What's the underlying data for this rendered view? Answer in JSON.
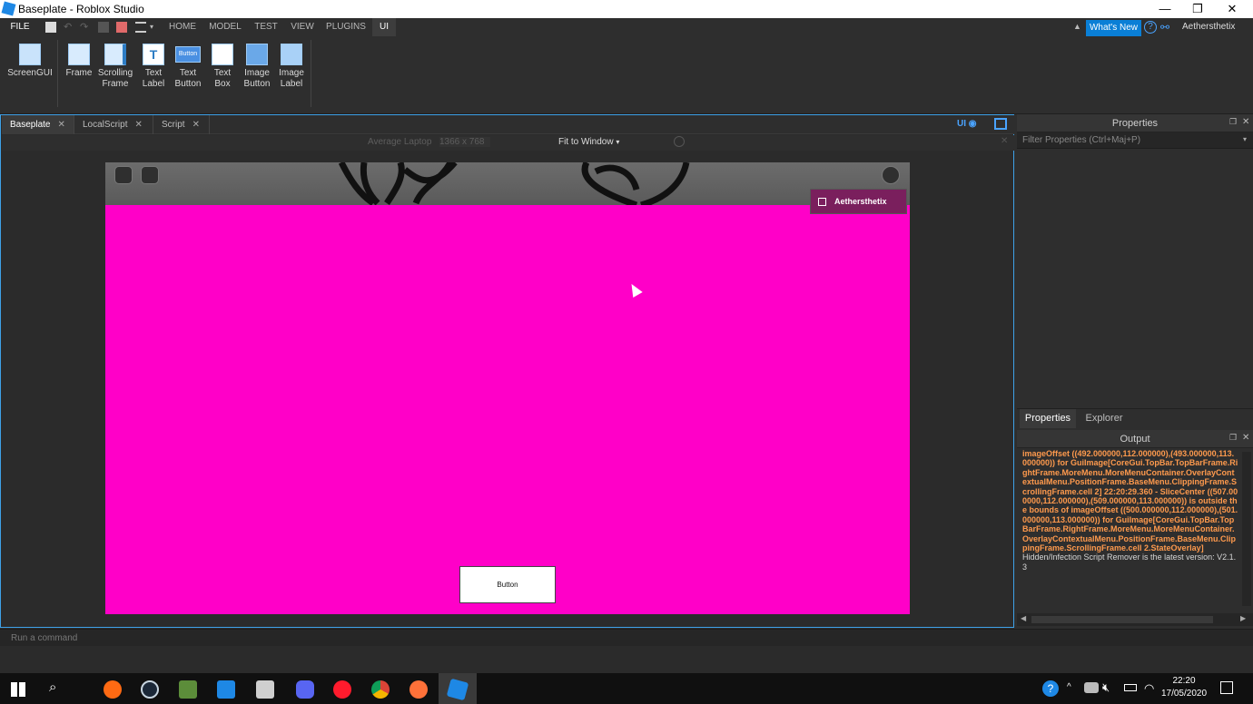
{
  "window": {
    "title": "Baseplate - Roblox Studio",
    "minimize": "—",
    "restore": "❐",
    "close": "✕"
  },
  "menu": {
    "file": "FILE",
    "tabs": [
      "HOME",
      "MODEL",
      "TEST",
      "VIEW",
      "PLUGINS",
      "UI"
    ],
    "active_tab": "UI",
    "whats_new": "What's New",
    "help": "?",
    "username": "Aethersthetix"
  },
  "ribbon": {
    "screengui": "ScreenGUI",
    "tools": [
      {
        "line1": "Frame",
        "line2": ""
      },
      {
        "line1": "Scrolling",
        "line2": "Frame"
      },
      {
        "line1": "Text",
        "line2": "Label"
      },
      {
        "line1": "Text",
        "line2": "Button"
      },
      {
        "line1": "Text",
        "line2": "Box"
      },
      {
        "line1": "Image",
        "line2": "Button"
      },
      {
        "line1": "Image",
        "line2": "Label"
      }
    ],
    "text_label_icon": "T",
    "text_button_icon": "Button"
  },
  "doc_tabs": [
    {
      "label": "Baseplate",
      "active": true
    },
    {
      "label": "LocalScript",
      "active": false
    },
    {
      "label": "Script",
      "active": false
    }
  ],
  "viewport": {
    "ui_toggle": "UI",
    "device": "Average Laptop",
    "resolution": "1366 x 768",
    "fit": "Fit to Window",
    "game_username": "Aethersthetix",
    "game_button": "Button",
    "background_color": "#ff00c8"
  },
  "properties": {
    "title": "Properties",
    "filter_placeholder": "Filter Properties (Ctrl+Maj+P)",
    "tabs": [
      "Properties",
      "Explorer"
    ]
  },
  "output": {
    "title": "Output",
    "warning_text": "imageOffset ((492.000000,112.000000),(493.000000,113.000000)) for GuiImage[CoreGui.TopBar.TopBarFrame.RightFrame.MoreMenu.MoreMenuContainer.OverlayContextualMenu.PositionFrame.BaseMenu.ClippingFrame.ScrollingFrame.cell 2] 22:20:29.360 - SliceCenter ((507.000000,112.000000),(509.000000,113.000000)) is outside the bounds of imageOffset ((500.000000,112.000000),(501.000000,113.000000)) for GuiImage[CoreGui.TopBar.TopBarFrame.RightFrame.MoreMenu.MoreMenuContainer.OverlayContextualMenu.PositionFrame.BaseMenu.ClippingFrame.ScrollingFrame.cell 2.StateOverlay]",
    "info_text": "Hidden/Infection Script Remover is the latest version: V2.1.3",
    "warning_color": "#ff9a4d"
  },
  "command_bar": {
    "placeholder": "Run a command"
  },
  "taskbar": {
    "time": "22:20",
    "date": "17/05/2020"
  }
}
